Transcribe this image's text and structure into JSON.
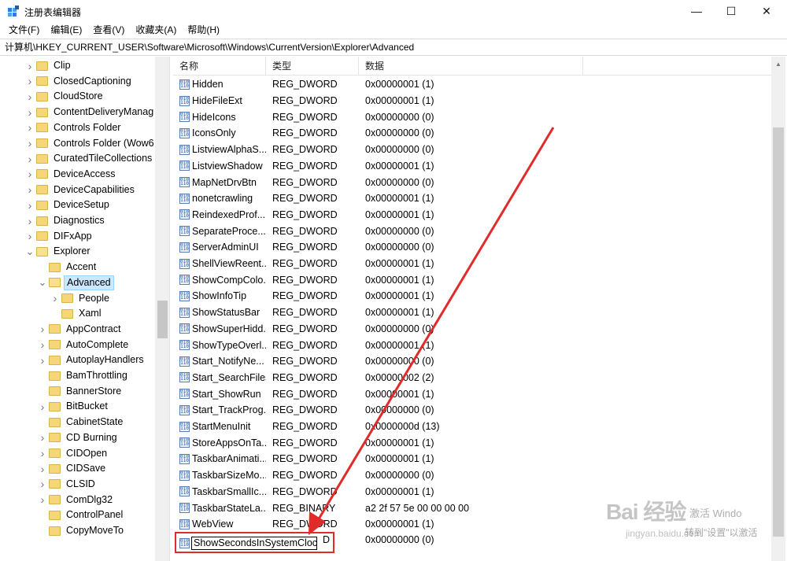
{
  "window": {
    "title": "注册表编辑器",
    "minimize": "—",
    "maximize": "☐",
    "close": "✕"
  },
  "menu": [
    "文件(F)",
    "编辑(E)",
    "查看(V)",
    "收藏夹(A)",
    "帮助(H)"
  ],
  "address": "计算机\\HKEY_CURRENT_USER\\Software\\Microsoft\\Windows\\CurrentVersion\\Explorer\\Advanced",
  "tree": [
    {
      "label": "Clip",
      "level": 0,
      "expander": "collapsed"
    },
    {
      "label": "ClosedCaptioning",
      "level": 0,
      "expander": "collapsed"
    },
    {
      "label": "CloudStore",
      "level": 0,
      "expander": "collapsed"
    },
    {
      "label": "ContentDeliveryManag",
      "level": 0,
      "expander": "collapsed"
    },
    {
      "label": "Controls Folder",
      "level": 0,
      "expander": "collapsed"
    },
    {
      "label": "Controls Folder (Wow6",
      "level": 0,
      "expander": "collapsed"
    },
    {
      "label": "CuratedTileCollections",
      "level": 0,
      "expander": "collapsed"
    },
    {
      "label": "DeviceAccess",
      "level": 0,
      "expander": "collapsed"
    },
    {
      "label": "DeviceCapabilities",
      "level": 0,
      "expander": "collapsed"
    },
    {
      "label": "DeviceSetup",
      "level": 0,
      "expander": "collapsed"
    },
    {
      "label": "Diagnostics",
      "level": 0,
      "expander": "collapsed"
    },
    {
      "label": "DIFxApp",
      "level": 0,
      "expander": "collapsed"
    },
    {
      "label": "Explorer",
      "level": 0,
      "expander": "expanded"
    },
    {
      "label": "Accent",
      "level": 1,
      "expander": "none"
    },
    {
      "label": "Advanced",
      "level": 1,
      "expander": "expanded",
      "selected": true
    },
    {
      "label": "People",
      "level": 2,
      "expander": "collapsed"
    },
    {
      "label": "Xaml",
      "level": 2,
      "expander": "none"
    },
    {
      "label": "AppContract",
      "level": 1,
      "expander": "collapsed"
    },
    {
      "label": "AutoComplete",
      "level": 1,
      "expander": "collapsed"
    },
    {
      "label": "AutoplayHandlers",
      "level": 1,
      "expander": "collapsed"
    },
    {
      "label": "BamThrottling",
      "level": 1,
      "expander": "none"
    },
    {
      "label": "BannerStore",
      "level": 1,
      "expander": "none"
    },
    {
      "label": "BitBucket",
      "level": 1,
      "expander": "collapsed"
    },
    {
      "label": "CabinetState",
      "level": 1,
      "expander": "none"
    },
    {
      "label": "CD Burning",
      "level": 1,
      "expander": "collapsed"
    },
    {
      "label": "CIDOpen",
      "level": 1,
      "expander": "collapsed"
    },
    {
      "label": "CIDSave",
      "level": 1,
      "expander": "collapsed"
    },
    {
      "label": "CLSID",
      "level": 1,
      "expander": "collapsed"
    },
    {
      "label": "ComDlg32",
      "level": 1,
      "expander": "collapsed"
    },
    {
      "label": "ControlPanel",
      "level": 1,
      "expander": "none"
    },
    {
      "label": "CopyMoveTo",
      "level": 1,
      "expander": "none"
    }
  ],
  "columns": {
    "name": "名称",
    "type": "类型",
    "data": "数据"
  },
  "values": [
    {
      "name": "Hidden",
      "type": "REG_DWORD",
      "data": "0x00000001 (1)"
    },
    {
      "name": "HideFileExt",
      "type": "REG_DWORD",
      "data": "0x00000001 (1)"
    },
    {
      "name": "HideIcons",
      "type": "REG_DWORD",
      "data": "0x00000000 (0)"
    },
    {
      "name": "IconsOnly",
      "type": "REG_DWORD",
      "data": "0x00000000 (0)"
    },
    {
      "name": "ListviewAlphaS...",
      "type": "REG_DWORD",
      "data": "0x00000000 (0)"
    },
    {
      "name": "ListviewShadow",
      "type": "REG_DWORD",
      "data": "0x00000001 (1)"
    },
    {
      "name": "MapNetDrvBtn",
      "type": "REG_DWORD",
      "data": "0x00000000 (0)"
    },
    {
      "name": "nonetcrawling",
      "type": "REG_DWORD",
      "data": "0x00000001 (1)"
    },
    {
      "name": "ReindexedProf...",
      "type": "REG_DWORD",
      "data": "0x00000001 (1)"
    },
    {
      "name": "SeparateProce...",
      "type": "REG_DWORD",
      "data": "0x00000000 (0)"
    },
    {
      "name": "ServerAdminUI",
      "type": "REG_DWORD",
      "data": "0x00000000 (0)"
    },
    {
      "name": "ShellViewReent...",
      "type": "REG_DWORD",
      "data": "0x00000001 (1)"
    },
    {
      "name": "ShowCompColo...",
      "type": "REG_DWORD",
      "data": "0x00000001 (1)"
    },
    {
      "name": "ShowInfoTip",
      "type": "REG_DWORD",
      "data": "0x00000001 (1)"
    },
    {
      "name": "ShowStatusBar",
      "type": "REG_DWORD",
      "data": "0x00000001 (1)"
    },
    {
      "name": "ShowSuperHidd...",
      "type": "REG_DWORD",
      "data": "0x00000000 (0)"
    },
    {
      "name": "ShowTypeOverl...",
      "type": "REG_DWORD",
      "data": "0x00000001 (1)"
    },
    {
      "name": "Start_NotifyNe...",
      "type": "REG_DWORD",
      "data": "0x00000000 (0)"
    },
    {
      "name": "Start_SearchFiles",
      "type": "REG_DWORD",
      "data": "0x00000002 (2)"
    },
    {
      "name": "Start_ShowRun",
      "type": "REG_DWORD",
      "data": "0x00000001 (1)"
    },
    {
      "name": "Start_TrackProg...",
      "type": "REG_DWORD",
      "data": "0x00000000 (0)"
    },
    {
      "name": "StartMenuInit",
      "type": "REG_DWORD",
      "data": "0x0000000d (13)"
    },
    {
      "name": "StoreAppsOnTa...",
      "type": "REG_DWORD",
      "data": "0x00000001 (1)"
    },
    {
      "name": "TaskbarAnimati...",
      "type": "REG_DWORD",
      "data": "0x00000001 (1)"
    },
    {
      "name": "TaskbarSizeMo...",
      "type": "REG_DWORD",
      "data": "0x00000000 (0)"
    },
    {
      "name": "TaskbarSmallIc...",
      "type": "REG_DWORD",
      "data": "0x00000001 (1)"
    },
    {
      "name": "TaskbarStateLa...",
      "type": "REG_BINARY",
      "data": "a2 2f 57 5e 00 00 00 00"
    },
    {
      "name": "WebView",
      "type": "REG_DWORD",
      "data": "0x00000001 (1)"
    }
  ],
  "editing": {
    "name": "ShowSecondsInSystemClock",
    "type": "D",
    "data": "0x00000000 (0)"
  },
  "watermark": {
    "logo": "Bai 经验",
    "url": "jingyan.baidu.com",
    "activate_title": "激活 Windo",
    "activate_hint": "转到\"设置\"以激活"
  },
  "accent_color": "#e12a2a"
}
